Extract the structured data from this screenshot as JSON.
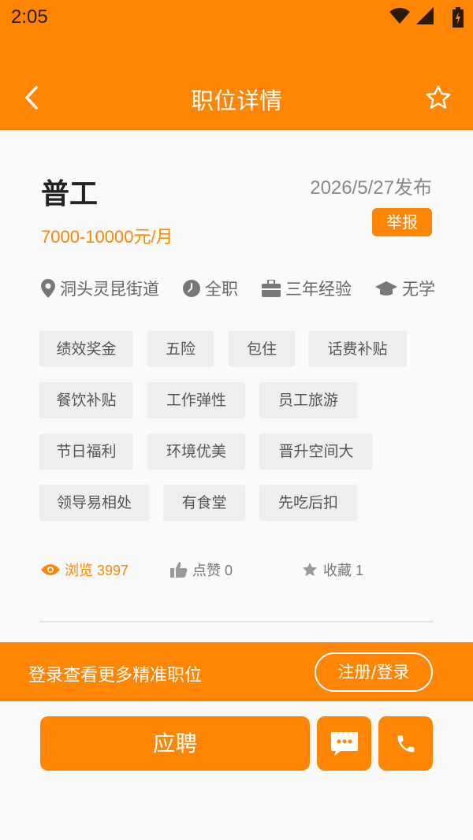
{
  "status_bar": {
    "time": "2:05",
    "icons": [
      "wifi-icon",
      "signal-icon",
      "battery-icon"
    ]
  },
  "header": {
    "title": "职位详情",
    "back_icon": "chevron-left-icon",
    "favorite_icon": "star-outline-icon"
  },
  "job": {
    "title": "普工",
    "published": "2026/5/27发布",
    "salary": "7000-10000元/月",
    "report_label": "举报",
    "meta": [
      {
        "icon": "location-icon",
        "text": "洞头灵昆街道"
      },
      {
        "icon": "clock-icon",
        "text": "全职"
      },
      {
        "icon": "briefcase-icon",
        "text": "三年经验"
      },
      {
        "icon": "graduation-cap-icon",
        "text": "无学历"
      }
    ],
    "benefits": [
      "绩效奖金",
      "五险",
      "包住",
      "话费补贴",
      "餐饮补贴",
      "工作弹性",
      "员工旅游",
      "节日福利",
      "环境优美",
      "晋升空间大",
      "领导易相处",
      "有食堂",
      "先吃后扣"
    ]
  },
  "stats": {
    "views": "浏览 3997",
    "likes": "点赞 0",
    "favorites": "收藏 1"
  },
  "login_banner": {
    "text": "登录查看更多精准职位",
    "button": "注册/登录"
  },
  "actions": {
    "apply": "应聘",
    "message_icon": "chat-bubble-icon",
    "call_icon": "phone-icon"
  },
  "colors": {
    "accent": "#ff8505",
    "tag_bg": "#eeeeee",
    "muted_text": "#888888"
  }
}
